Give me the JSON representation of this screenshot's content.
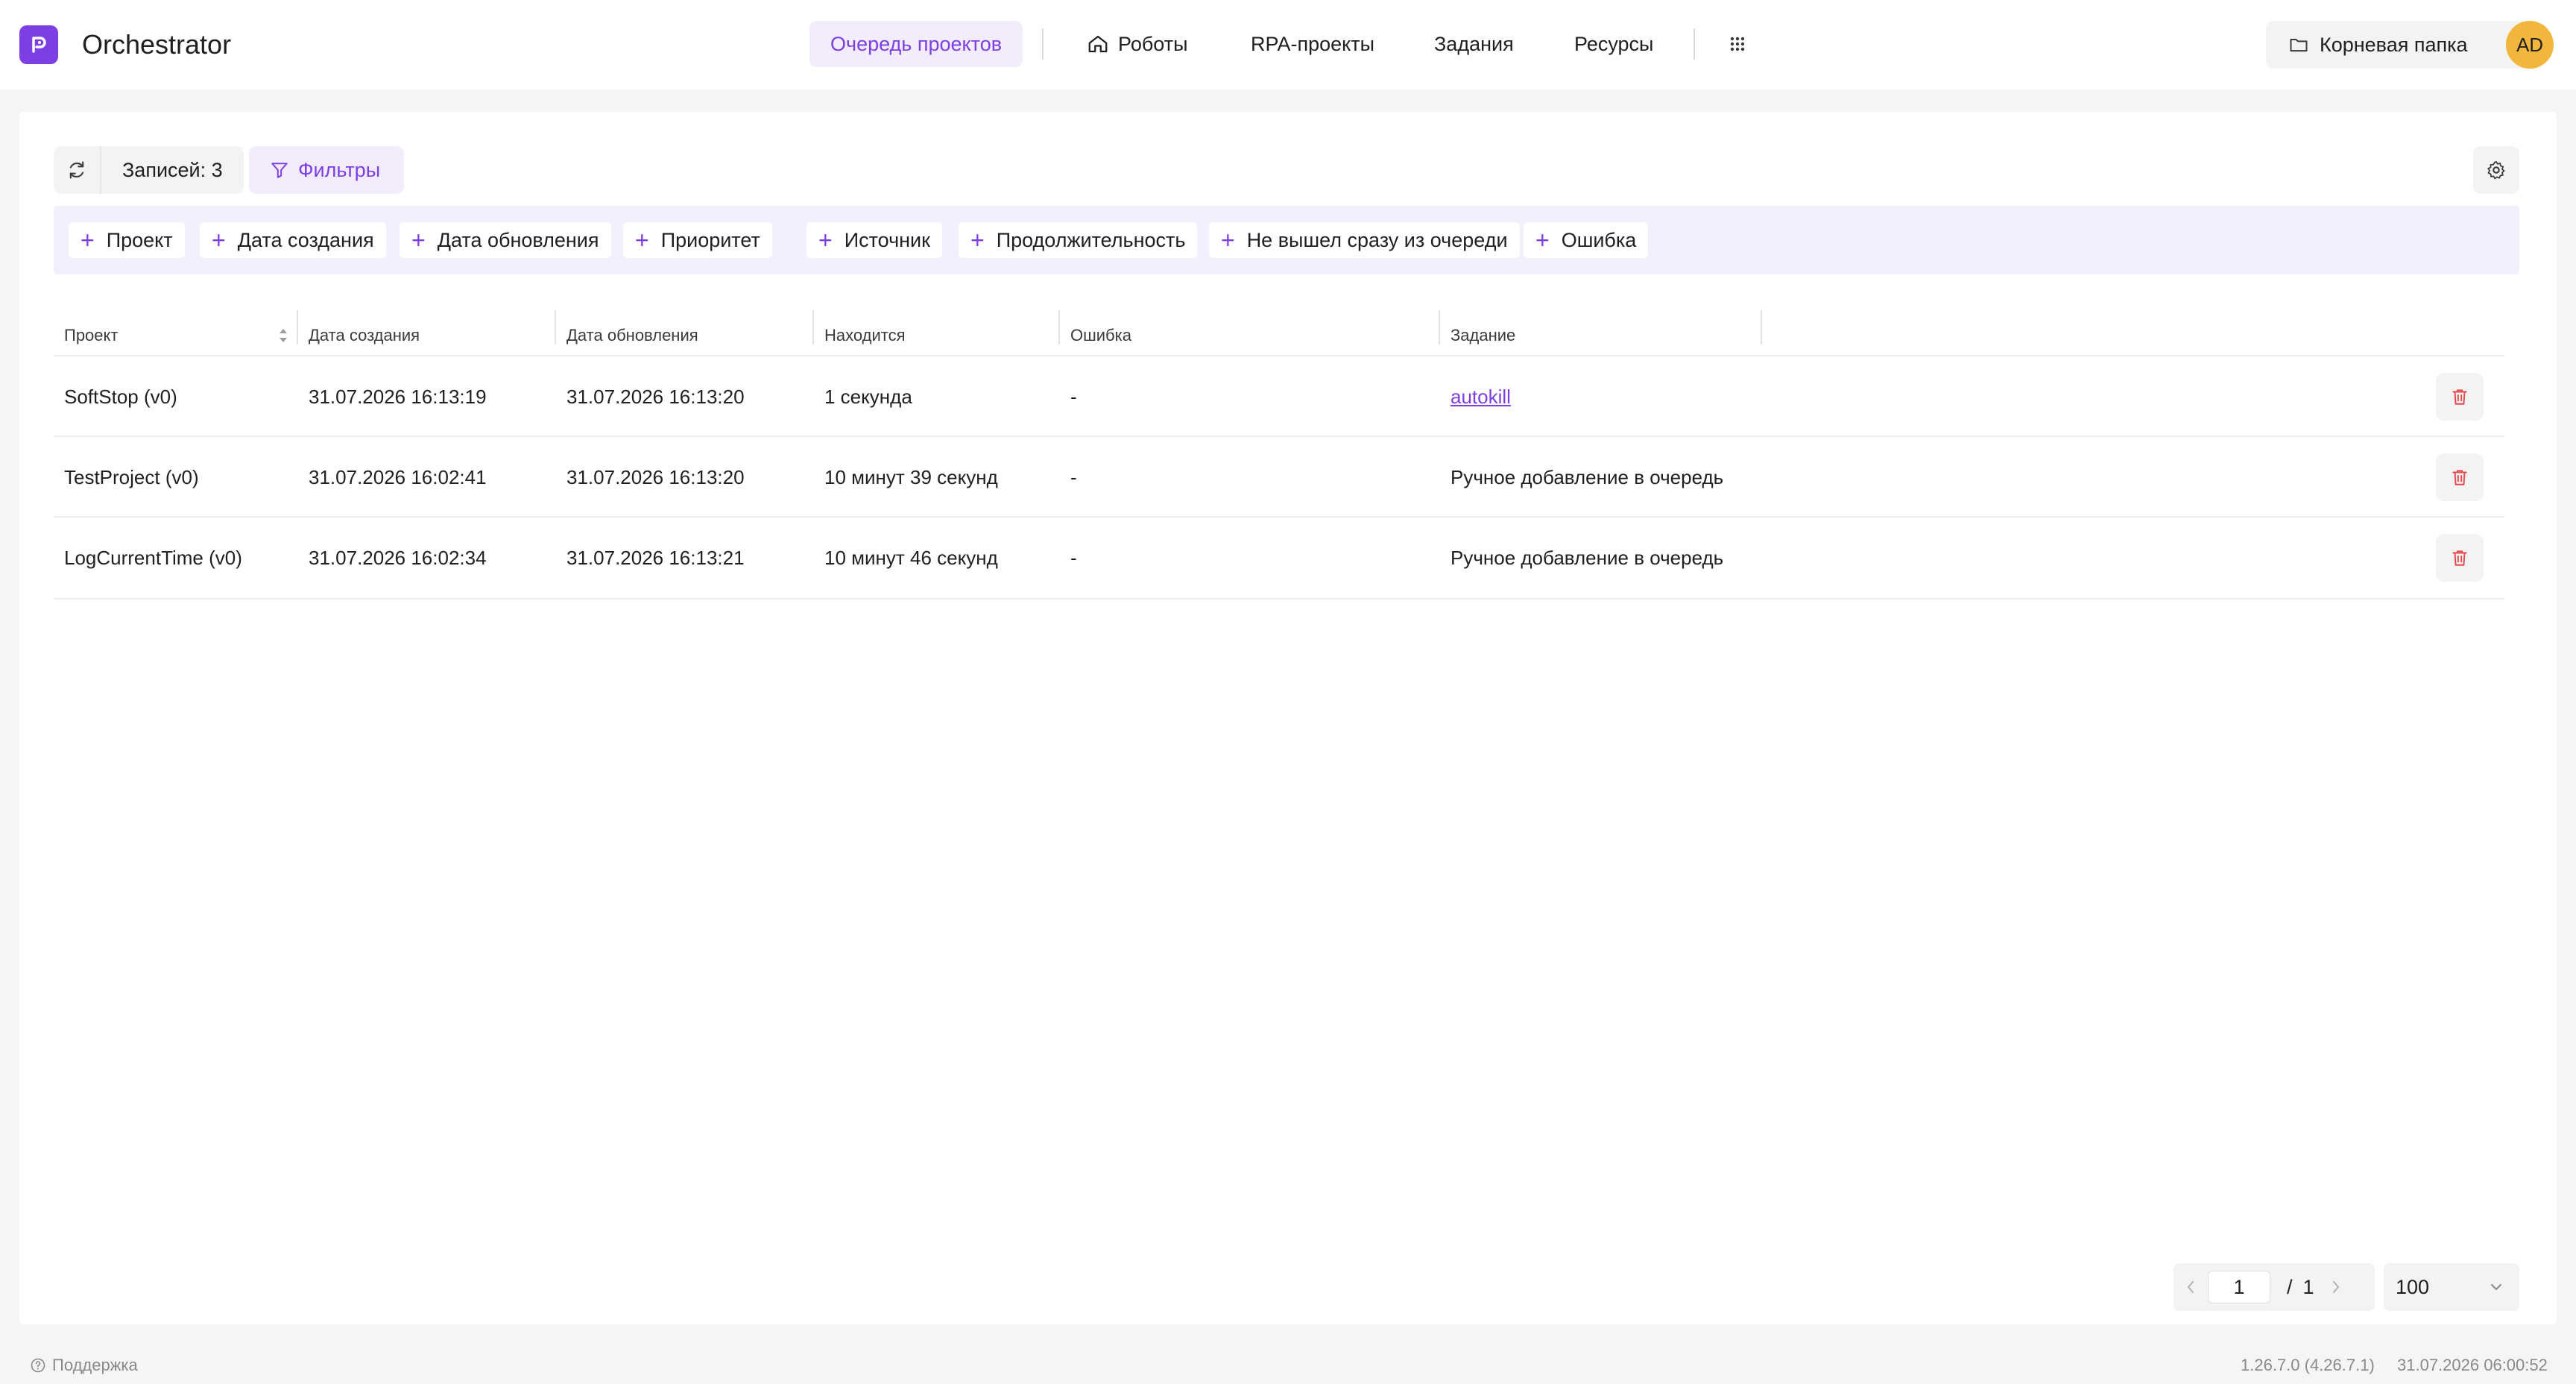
{
  "app": {
    "title": "Orchestrator"
  },
  "nav": {
    "items": [
      {
        "label": "Очередь проектов",
        "active": true
      },
      {
        "label": "Роботы",
        "icon": "home-icon"
      },
      {
        "label": "RPA-проекты"
      },
      {
        "label": "Задания"
      },
      {
        "label": "Ресурсы"
      }
    ],
    "apps_icon": "grid-icon"
  },
  "header": {
    "root_folder_label": "Корневая папка",
    "avatar_initials": "AD"
  },
  "toolbar": {
    "records_label": "Записей: 3",
    "filters_label": "Фильтры"
  },
  "filter_chips": [
    "Проект",
    "Дата создания",
    "Дата обновления",
    "Приоритет",
    "Источник",
    "Продолжительность",
    "Не вышел сразу из очереди",
    "Ошибка"
  ],
  "table": {
    "columns": [
      "Проект",
      "Дата создания",
      "Дата обновления",
      "Находится",
      "Ошибка",
      "Задание"
    ],
    "rows": [
      {
        "project": "SoftStop (v0)",
        "created": "31.07.2026 16:13:19",
        "updated": "31.07.2026 16:13:20",
        "duration": "1 секунда",
        "error": "-",
        "task": "autokill",
        "task_is_link": true
      },
      {
        "project": "TestProject (v0)",
        "created": "31.07.2026 16:02:41",
        "updated": "31.07.2026 16:13:20",
        "duration": "10 минут 39 секунд",
        "error": "-",
        "task": "Ручное добавление в очередь",
        "task_is_link": false
      },
      {
        "project": "LogCurrentTime (v0)",
        "created": "31.07.2026 16:02:34",
        "updated": "31.07.2026 16:13:21",
        "duration": "10 минут 46 секунд",
        "error": "-",
        "task": "Ручное добавление в очередь",
        "task_is_link": false
      }
    ]
  },
  "pagination": {
    "current_page": "1",
    "separator": "/",
    "total_pages": "1",
    "page_size": "100"
  },
  "footer": {
    "support_label": "Поддержка",
    "version": "1.26.7.0 (4.26.7.1)",
    "datetime": "31.07.2026 06:00:52"
  },
  "colors": {
    "accent": "#7b3fe4",
    "accent_bg": "#f2ecfd",
    "avatar": "#f3b63d",
    "delete": "#e5484d"
  }
}
